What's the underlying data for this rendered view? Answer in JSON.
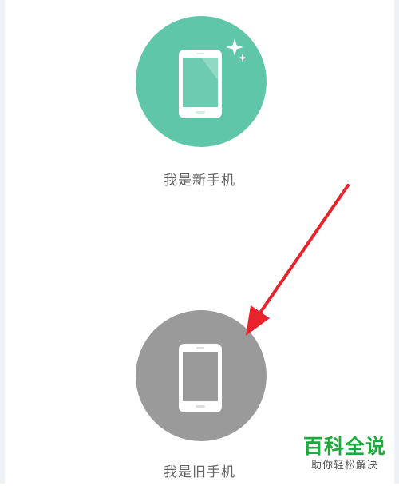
{
  "options": {
    "new_phone": {
      "label": "我是新手机",
      "icon": "phone-with-sparkle-icon",
      "circle_color": "#5fc6a9"
    },
    "old_phone": {
      "label": "我是旧手机",
      "icon": "phone-icon",
      "circle_color": "#9a9a9a"
    }
  },
  "annotation": {
    "icon": "red-arrow-icon",
    "color": "#e8232b"
  },
  "watermark": {
    "title": "百科全说",
    "subtitle": "助你轻松解决",
    "color": "#1aab3a"
  }
}
